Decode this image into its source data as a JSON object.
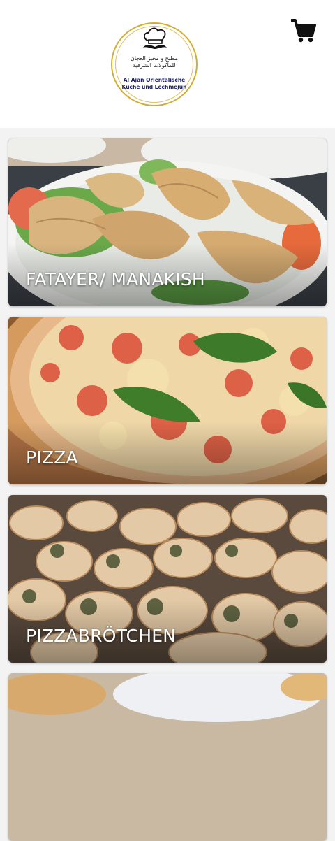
{
  "header": {
    "logo": {
      "arabic_line1": "مطبخ و مخبز العجان",
      "arabic_line2": "للمأكولات الشرقية",
      "latin_line1": "Al Ajan Orientalische",
      "latin_line2": "Küche und Lechmejun",
      "icon": "chef-hat-mustache-icon"
    },
    "cart_icon": "shopping-cart-icon"
  },
  "categories": [
    {
      "label": "FATAYER/ MANAKISH"
    },
    {
      "label": "PIZZA"
    },
    {
      "label": "PIZZABRÖTCHEN"
    },
    {
      "label": ""
    }
  ],
  "colors": {
    "background": "#f3f3f3",
    "header": "#ffffff",
    "logo_gold": "#d2ae33",
    "label_text": "#ffffff"
  }
}
